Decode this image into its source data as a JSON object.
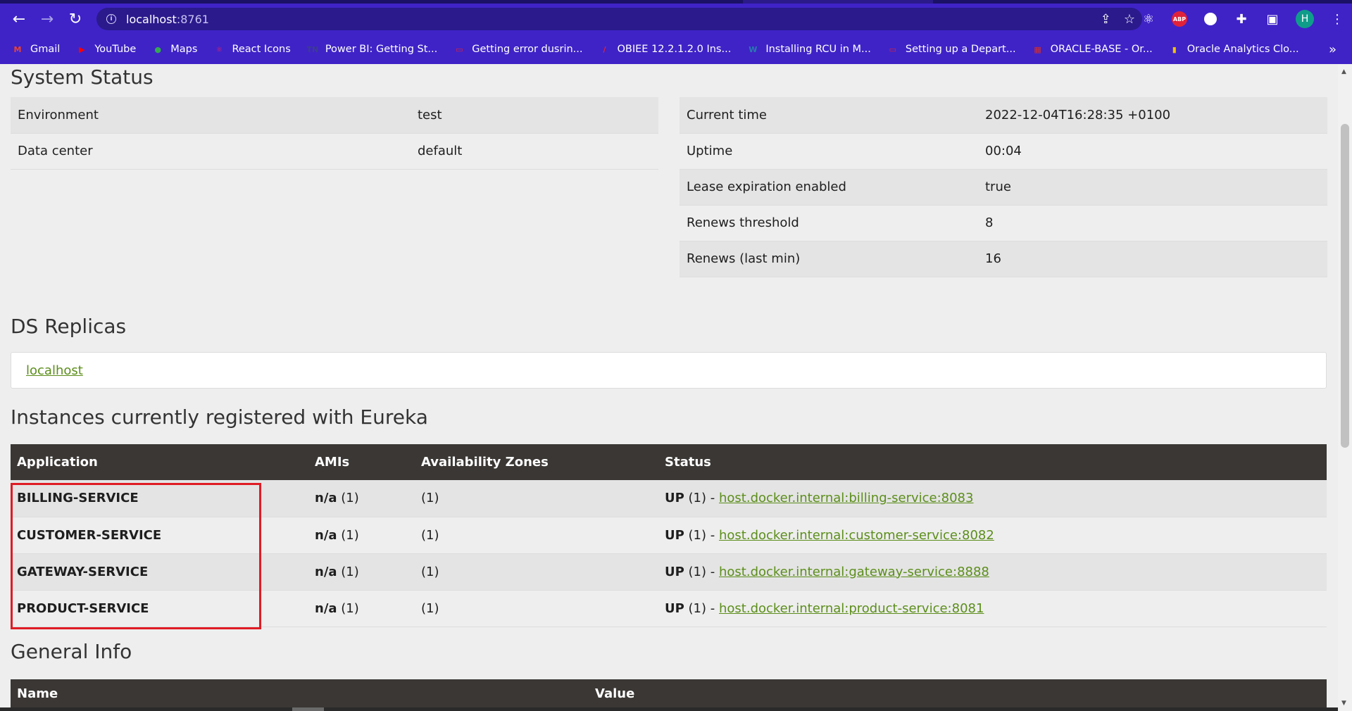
{
  "browser": {
    "url_host": "localhost",
    "url_port": ":8761",
    "avatar_letter": "H",
    "abp_label": "ABP",
    "bookmarks": [
      {
        "label": "Gmail",
        "icon": "gmail-icon",
        "glyph": "M",
        "color": "#ea4335"
      },
      {
        "label": "YouTube",
        "icon": "youtube-icon",
        "glyph": "▶",
        "color": "#ff0000"
      },
      {
        "label": "Maps",
        "icon": "maps-icon",
        "glyph": "●",
        "color": "#34a853"
      },
      {
        "label": "React Icons",
        "icon": "react-icon",
        "glyph": "⚛",
        "color": "#e91e63"
      },
      {
        "label": "Power BI: Getting St...",
        "icon": "tn-icon",
        "glyph": "TN",
        "color": "#3d3d8f"
      },
      {
        "label": "Getting error dusrin...",
        "icon": "oracle-icon",
        "glyph": "▭",
        "color": "#e0233a"
      },
      {
        "label": "OBIEE 12.2.1.2.0 Ins...",
        "icon": "slash-icon",
        "glyph": "/",
        "color": "#e0233a"
      },
      {
        "label": "Installing RCU in M...",
        "icon": "wordpress-icon",
        "glyph": "W",
        "color": "#2a7ab0"
      },
      {
        "label": "Setting up a Depart...",
        "icon": "oracle-icon",
        "glyph": "▭",
        "color": "#e0233a"
      },
      {
        "label": "ORACLE-BASE - Or...",
        "icon": "oraclebase-icon",
        "glyph": "▦",
        "color": "#d32f2f"
      },
      {
        "label": "Oracle Analytics Clo...",
        "icon": "flag-icon",
        "glyph": "▮",
        "color": "#f2c200"
      }
    ]
  },
  "system_status": {
    "title": "System Status",
    "left": [
      {
        "key": "Environment",
        "value": "test"
      },
      {
        "key": "Data center",
        "value": "default"
      }
    ],
    "right": [
      {
        "key": "Current time",
        "value": "2022-12-04T16:28:35 +0100"
      },
      {
        "key": "Uptime",
        "value": "00:04"
      },
      {
        "key": "Lease expiration enabled",
        "value": "true"
      },
      {
        "key": "Renews threshold",
        "value": "8"
      },
      {
        "key": "Renews (last min)",
        "value": "16"
      }
    ]
  },
  "replicas": {
    "title": "DS Replicas",
    "link": "localhost"
  },
  "instances": {
    "title": "Instances currently registered with Eureka",
    "columns": [
      "Application",
      "AMIs",
      "Availability Zones",
      "Status"
    ],
    "rows": [
      {
        "app": "BILLING-SERVICE",
        "amis_bold": "n/a",
        "amis_rest": " (1)",
        "zones": "(1)",
        "status_bold": "UP",
        "status_rest": " (1) - ",
        "link": "host.docker.internal:billing-service:8083"
      },
      {
        "app": "CUSTOMER-SERVICE",
        "amis_bold": "n/a",
        "amis_rest": " (1)",
        "zones": "(1)",
        "status_bold": "UP",
        "status_rest": " (1) - ",
        "link": "host.docker.internal:customer-service:8082"
      },
      {
        "app": "GATEWAY-SERVICE",
        "amis_bold": "n/a",
        "amis_rest": " (1)",
        "zones": "(1)",
        "status_bold": "UP",
        "status_rest": " (1) - ",
        "link": "host.docker.internal:gateway-service:8888"
      },
      {
        "app": "PRODUCT-SERVICE",
        "amis_bold": "n/a",
        "amis_rest": " (1)",
        "zones": "(1)",
        "status_bold": "UP",
        "status_rest": " (1) - ",
        "link": "host.docker.internal:product-service:8081"
      }
    ]
  },
  "general_info": {
    "title": "General Info",
    "columns": [
      "Name",
      "Value"
    ]
  },
  "colors": {
    "chrome": "#3f23c7",
    "link": "#5c8e1b",
    "table_header": "#3a3734",
    "highlight": "#e01b24"
  }
}
